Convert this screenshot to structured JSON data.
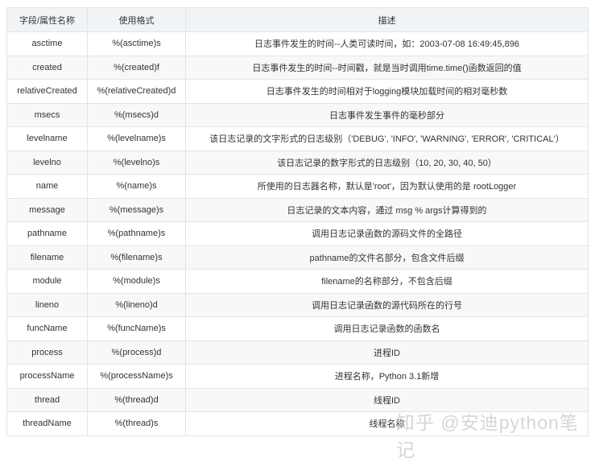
{
  "headers": [
    "字段/属性名称",
    "使用格式",
    "描述"
  ],
  "rows": [
    [
      "asctime",
      "%(asctime)s",
      "日志事件发生的时间--人类可读时间，如：2003-07-08 16:49:45,896"
    ],
    [
      "created",
      "%(created)f",
      "日志事件发生的时间--时间戳，就是当时调用time.time()函数返回的值"
    ],
    [
      "relativeCreated",
      "%(relativeCreated)d",
      "日志事件发生的时间相对于logging模块加载时间的相对毫秒数"
    ],
    [
      "msecs",
      "%(msecs)d",
      "日志事件发生事件的毫秒部分"
    ],
    [
      "levelname",
      "%(levelname)s",
      "该日志记录的文字形式的日志级别（'DEBUG', 'INFO', 'WARNING', 'ERROR', 'CRITICAL'）"
    ],
    [
      "levelno",
      "%(levelno)s",
      "该日志记录的数字形式的日志级别（10, 20, 30, 40, 50）"
    ],
    [
      "name",
      "%(name)s",
      "所使用的日志器名称，默认是'root'，因为默认使用的是 rootLogger"
    ],
    [
      "message",
      "%(message)s",
      "日志记录的文本内容，通过 msg % args计算得到的"
    ],
    [
      "pathname",
      "%(pathname)s",
      "调用日志记录函数的源码文件的全路径"
    ],
    [
      "filename",
      "%(filename)s",
      "pathname的文件名部分，包含文件后缀"
    ],
    [
      "module",
      "%(module)s",
      "filename的名称部分，不包含后缀"
    ],
    [
      "lineno",
      "%(lineno)d",
      "调用日志记录函数的源代码所在的行号"
    ],
    [
      "funcName",
      "%(funcName)s",
      "调用日志记录函数的函数名"
    ],
    [
      "process",
      "%(process)d",
      "进程ID"
    ],
    [
      "processName",
      "%(processName)s",
      "进程名称，Python 3.1新增"
    ],
    [
      "thread",
      "%(thread)d",
      "线程ID"
    ],
    [
      "threadName",
      "%(thread)s",
      "线程名称"
    ]
  ],
  "watermark": "知乎 @安迪python笔记"
}
